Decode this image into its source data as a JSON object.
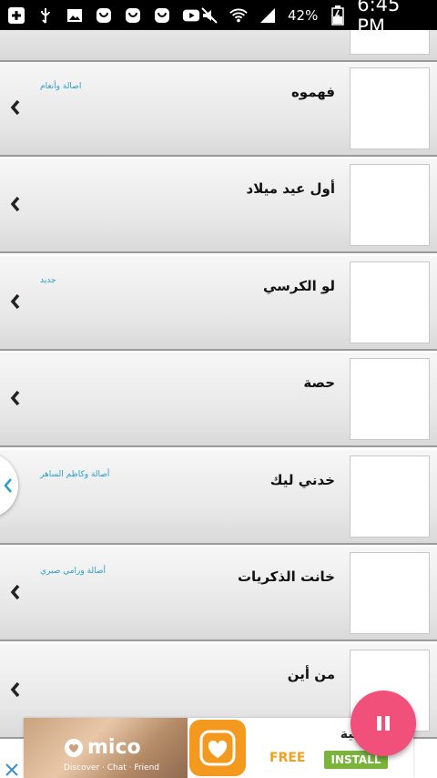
{
  "status_bar": {
    "battery_percent": "42%",
    "time": "6:45 PM",
    "icons_left": [
      "plus-icon",
      "usb-icon",
      "image-icon",
      "app-icon",
      "app-icon",
      "app-icon",
      "youtube-icon"
    ],
    "icons_right": [
      "mute-icon",
      "wifi-icon",
      "signal-icon",
      "battery-icon"
    ]
  },
  "songs": [
    {
      "title": "",
      "artist": ""
    },
    {
      "title": "فهموه",
      "artist": "اصالة وأنغام"
    },
    {
      "title": "أول عيد ميلاد",
      "artist": ""
    },
    {
      "title": "لو الكرسي",
      "artist": "جديد"
    },
    {
      "title": "حصة",
      "artist": ""
    },
    {
      "title": "خدني ليك",
      "artist": "أصالة وكاظم الساهر"
    },
    {
      "title": "خانت الذكريات",
      "artist": "أصالة ورامي صبري"
    },
    {
      "title": "من أين",
      "artist": ""
    }
  ],
  "ad": {
    "brand": "mico",
    "tagline": "Discover · Chat · Friend",
    "headline": "لغة عربية",
    "free_label": "FREE",
    "install_label": "INSTALL"
  },
  "fab": {
    "icon": "pause-icon"
  },
  "colors": {
    "accent": "#f0507a",
    "artist_text": "#2b9fc7",
    "install_button": "#7ab43c",
    "free_text": "#f0a020"
  }
}
